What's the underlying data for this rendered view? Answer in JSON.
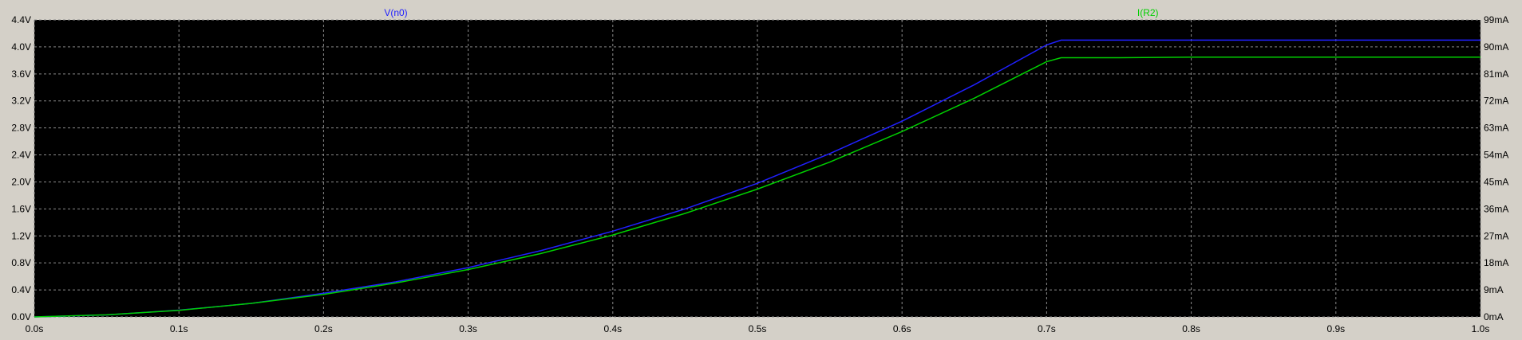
{
  "chart_data": {
    "type": "line",
    "x": [
      0.0,
      0.05,
      0.1,
      0.15,
      0.2,
      0.25,
      0.3,
      0.35,
      0.4,
      0.45,
      0.5,
      0.55,
      0.6,
      0.65,
      0.7,
      0.71,
      0.75,
      0.8,
      0.85,
      0.9,
      0.95,
      1.0
    ],
    "x_ticks": [
      "0.0s",
      "0.1s",
      "0.2s",
      "0.3s",
      "0.4s",
      "0.5s",
      "0.6s",
      "0.7s",
      "0.8s",
      "0.9s",
      "1.0s"
    ],
    "xlim": [
      0,
      1.0
    ],
    "grid": true,
    "series": [
      {
        "name": "V(n0)",
        "color": "#2020ff",
        "axis": "left",
        "values": [
          0.0,
          0.03,
          0.1,
          0.2,
          0.35,
          0.52,
          0.73,
          0.98,
          1.27,
          1.6,
          1.98,
          2.42,
          2.9,
          3.44,
          4.03,
          4.1,
          4.1,
          4.1,
          4.1,
          4.1,
          4.1,
          4.1
        ]
      },
      {
        "name": "I(R2)",
        "color": "#00d000",
        "axis": "right",
        "values": [
          0.0,
          0.7,
          2.2,
          4.5,
          7.5,
          11.3,
          15.8,
          21.1,
          27.3,
          34.5,
          42.6,
          51.6,
          61.8,
          72.9,
          85.1,
          86.4,
          86.4,
          86.6,
          86.6,
          86.6,
          86.6,
          86.6
        ]
      }
    ],
    "left_axis": {
      "ticks": [
        "0.0V",
        "0.4V",
        "0.8V",
        "1.2V",
        "1.6V",
        "2.0V",
        "2.4V",
        "2.8V",
        "3.2V",
        "3.6V",
        "4.0V",
        "4.4V"
      ],
      "ylim": [
        0,
        4.4
      ]
    },
    "right_axis": {
      "ticks": [
        "0mA",
        "9mA",
        "18mA",
        "27mA",
        "36mA",
        "45mA",
        "54mA",
        "63mA",
        "72mA",
        "81mA",
        "90mA",
        "99mA"
      ],
      "ylim": [
        0,
        99
      ]
    }
  }
}
